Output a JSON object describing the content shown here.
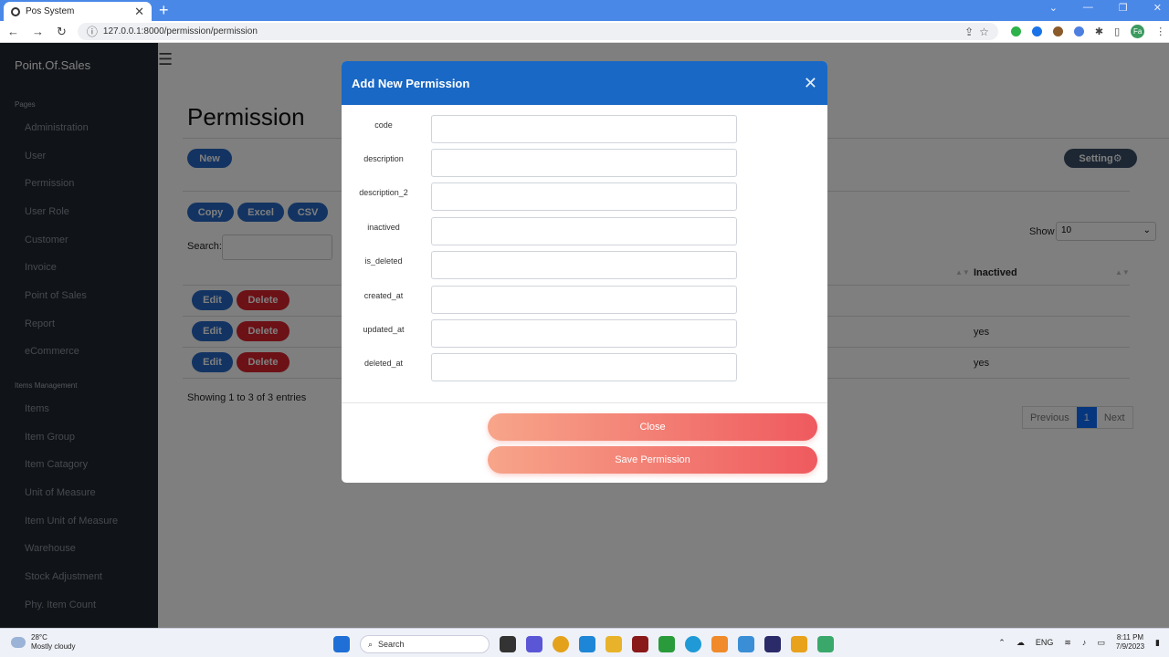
{
  "browser": {
    "tab_title": "Pos System",
    "tab_close": "✕",
    "new_tab": "+",
    "url": "127.0.0.1:8000/permission/permission",
    "profile": "Fa"
  },
  "sidebar": {
    "brand": "Point.Of.Sales",
    "section_pages": "Pages",
    "pages": [
      "Administration",
      "User",
      "Permission",
      "User Role",
      "Customer",
      "Invoice",
      "Point of Sales",
      "Report",
      "eCommerce"
    ],
    "section_items": "Items Management",
    "items": [
      "Items",
      "Item Group",
      "Item Catagory",
      "Unit of Measure",
      "Item Unit of Measure",
      "Warehouse",
      "Stock Adjustment",
      "Phy. Item Count"
    ]
  },
  "main": {
    "page_title": "Permission",
    "new_label": "New",
    "setting_label": "Setting⚙",
    "export_buttons": [
      "Copy",
      "Excel",
      "CSV"
    ],
    "search_label": "Search:",
    "show_label": "Show",
    "show_value": "10",
    "col_inactived": "Inactived",
    "rows": [
      {
        "edit": "Edit",
        "delete": "Delete",
        "inactived": ""
      },
      {
        "edit": "Edit",
        "delete": "Delete",
        "inactived": "yes"
      },
      {
        "edit": "Edit",
        "delete": "Delete",
        "inactived": "yes"
      }
    ],
    "info": "Showing 1 to 3 of 3 entries",
    "pager": {
      "previous": "Previous",
      "current": "1",
      "next": "Next"
    }
  },
  "modal": {
    "title": "Add New Permission",
    "fields": [
      {
        "label": "code",
        "value": ""
      },
      {
        "label": "description",
        "value": ""
      },
      {
        "label": "description_2",
        "value": ""
      },
      {
        "label": "inactived",
        "value": ""
      },
      {
        "label": "is_deleted",
        "value": ""
      },
      {
        "label": "created_at",
        "value": ""
      },
      {
        "label": "updated_at",
        "value": ""
      },
      {
        "label": "deleted_at",
        "value": ""
      }
    ],
    "close_label": "Close",
    "save_label": "Save Permission"
  },
  "taskbar": {
    "temp": "28°C",
    "weather": "Mostly cloudy",
    "search_placeholder": "Search",
    "lang": "ENG",
    "time": "8:11 PM",
    "date": "7/9/2023"
  }
}
